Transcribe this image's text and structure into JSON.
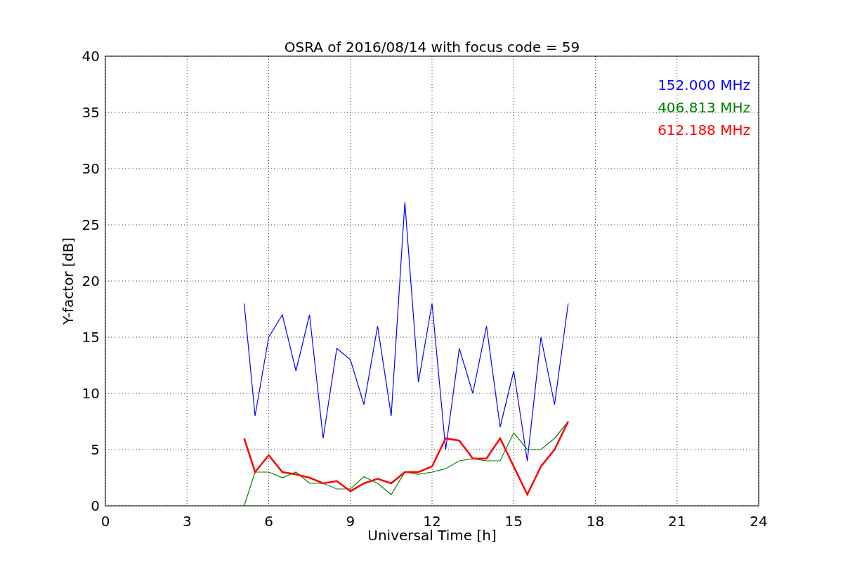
{
  "chart_data": {
    "type": "line",
    "title": "OSRA of 2016/08/14 with focus code = 59",
    "xlabel": "Universal Time [h]",
    "ylabel": "Y-factor [dB]",
    "x": [
      5.1,
      5.5,
      6,
      6.5,
      7,
      7.5,
      8,
      8.5,
      9,
      9.5,
      10,
      10.5,
      11,
      11.5,
      12,
      12.5,
      13,
      13.5,
      14,
      14.5,
      15,
      15.5,
      16,
      16.5,
      17
    ],
    "series": [
      {
        "name": "152.000 MHz",
        "color": "#0000ff",
        "values": [
          18,
          8,
          15,
          17,
          12,
          17,
          6,
          14,
          13,
          9,
          16,
          8,
          27,
          11,
          18,
          5,
          14,
          10,
          16,
          7,
          12,
          4,
          15,
          9,
          18
        ]
      },
      {
        "name": "406.813 MHz",
        "color": "#008000",
        "values": [
          0,
          3,
          3,
          2.5,
          3,
          2,
          2,
          1.5,
          1.5,
          2.6,
          2,
          1,
          3,
          2.8,
          3,
          3.3,
          4,
          4.2,
          4,
          4,
          6.5,
          5,
          5,
          6,
          7.5
        ]
      },
      {
        "name": "612.188 MHz",
        "color": "#ff0000",
        "values": [
          6,
          3,
          4.5,
          3,
          2.8,
          2.5,
          2,
          2.2,
          1.3,
          2,
          2.4,
          2,
          3,
          3,
          3.5,
          6,
          5.8,
          4.2,
          4.2,
          6,
          3.5,
          1,
          3.5,
          5,
          7.5
        ]
      }
    ],
    "grid": true,
    "xlim": [
      0,
      24
    ],
    "ylim": [
      0,
      40
    ],
    "xticks": [
      0,
      3,
      6,
      9,
      12,
      15,
      18,
      21,
      24
    ],
    "yticks": [
      0,
      5,
      10,
      15,
      20,
      25,
      30,
      35,
      40
    ]
  }
}
